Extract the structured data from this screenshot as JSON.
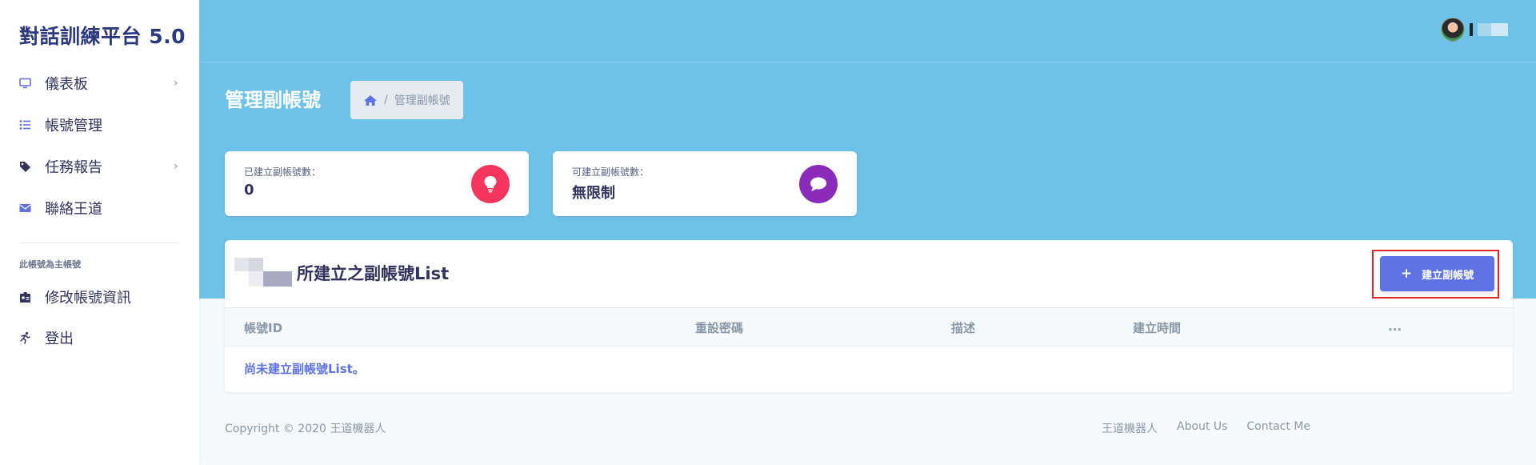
{
  "sidebar": {
    "brand": "對話訓練平台 5.0",
    "items": [
      {
        "label": "儀表板",
        "icon": "monitor-icon",
        "has_chevron": true
      },
      {
        "label": "帳號管理",
        "icon": "list-icon",
        "has_chevron": false
      },
      {
        "label": "任務報告",
        "icon": "tag-icon",
        "has_chevron": true
      },
      {
        "label": "聯絡王道",
        "icon": "envelope-icon",
        "has_chevron": false
      }
    ],
    "section_heading": "此帳號為主帳號",
    "account_items": [
      {
        "label": "修改帳號資訊",
        "icon": "id-card-icon"
      },
      {
        "label": "登出",
        "icon": "running-person-icon"
      }
    ],
    "chevron": "›"
  },
  "header": {
    "page_title": "管理副帳號",
    "breadcrumb": {
      "separator": "/",
      "current": "管理副帳號"
    }
  },
  "stats": [
    {
      "label": "已建立副帳號數：",
      "value": "0",
      "icon": "lightbulb-icon",
      "color": "#f5365c"
    },
    {
      "label": "可建立副帳號數：",
      "value": "無限制",
      "icon": "chat-bubble-icon",
      "color": "#8b2bb9"
    }
  ],
  "list": {
    "title": "所建立之副帳號List",
    "add_button": {
      "plus": "+",
      "label": "建立副帳號"
    },
    "columns": [
      "帳號ID",
      "重設密碼",
      "描述",
      "建立時間",
      "..."
    ],
    "empty_message": "尚未建立副帳號List。"
  },
  "footer": {
    "copyright": "Copyright © 2020 王道機器人",
    "links": [
      "王道機器人",
      "About Us",
      "Contact Me"
    ]
  },
  "colors": {
    "header_bg": "#6ec1e8",
    "accent": "#5e72e4",
    "highlight": "#e0262b"
  }
}
